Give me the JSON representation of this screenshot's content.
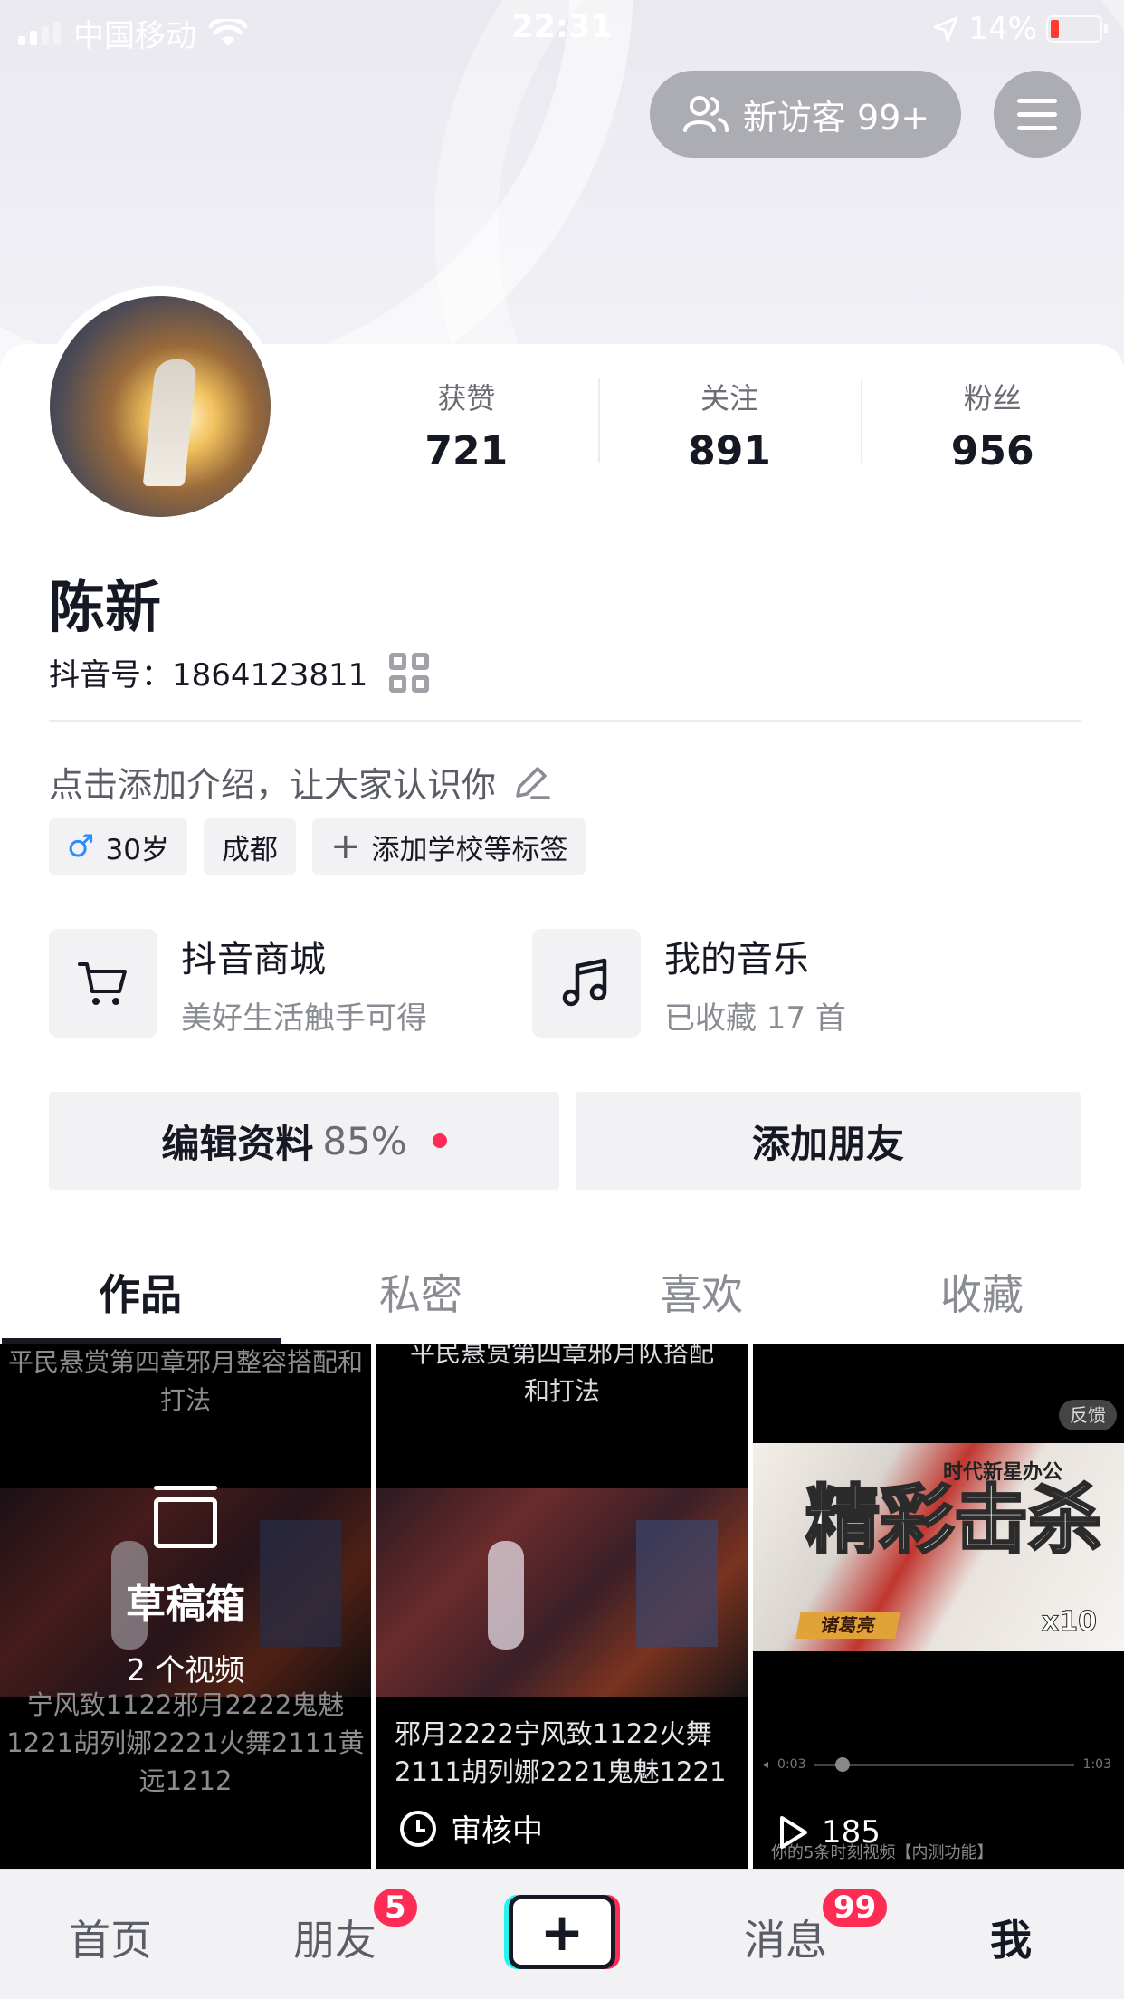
{
  "status_bar": {
    "carrier": "中国移动",
    "time": "22:31",
    "battery": "14%"
  },
  "header": {
    "visitor_button": "新访客 99+",
    "menu_icon": "hamburger-icon"
  },
  "profile": {
    "stats": [
      {
        "label": "获赞",
        "value": "721"
      },
      {
        "label": "关注",
        "value": "891"
      },
      {
        "label": "粉丝",
        "value": "956"
      }
    ],
    "name": "陈新",
    "douyin_id": "抖音号：1864123811",
    "bio_placeholder": "点击添加介绍，让大家认识你",
    "tags": {
      "gender_icon": "♂",
      "age": "30岁",
      "city": "成都",
      "add_tag": "添加学校等标签"
    }
  },
  "shortcuts": [
    {
      "title": "抖音商城",
      "subtitle": "美好生活触手可得",
      "icon": "cart-icon"
    },
    {
      "title": "我的音乐",
      "subtitle": "已收藏 17 首",
      "icon": "music-note-icon"
    }
  ],
  "actions": {
    "edit_profile": "编辑资料",
    "edit_progress": "85%",
    "add_friend": "添加朋友"
  },
  "tabs": [
    "作品",
    "私密",
    "喜欢",
    "收藏"
  ],
  "videos": [
    {
      "caption_top": "平民悬赏第四章邪月整容搭配和打法",
      "caption_bottom": "宁风致1122邪月2222鬼魅1221胡列娜2221火舞2111黄远1212",
      "draft_title": "草稿箱",
      "draft_count": "2 个视频"
    },
    {
      "caption_top": "平民悬赏第四章邪月队搭配和打法",
      "caption_bottom": "邪月2222宁风致1122火舞2111胡列娜2221鬼魅1221",
      "status": "审核中"
    },
    {
      "feedback": "反馈",
      "promo_title": "精彩击杀",
      "promo_subtitle": "时代新星办公",
      "promo_multiplier": "x10",
      "hero_name": "诸葛亮",
      "time_start": "0:03",
      "time_end": "1:03",
      "plays": "185",
      "note": "你的5条时刻视频【内测功能】"
    }
  ],
  "bottom_nav": {
    "home": "首页",
    "friends": "朋友",
    "friends_badge": "5",
    "create": "+",
    "messages": "消息",
    "messages_badge": "99",
    "me": "我"
  },
  "colors": {
    "accent_red": "#fe2c55",
    "accent_cyan": "#25f4ee",
    "text_primary": "#161823"
  }
}
